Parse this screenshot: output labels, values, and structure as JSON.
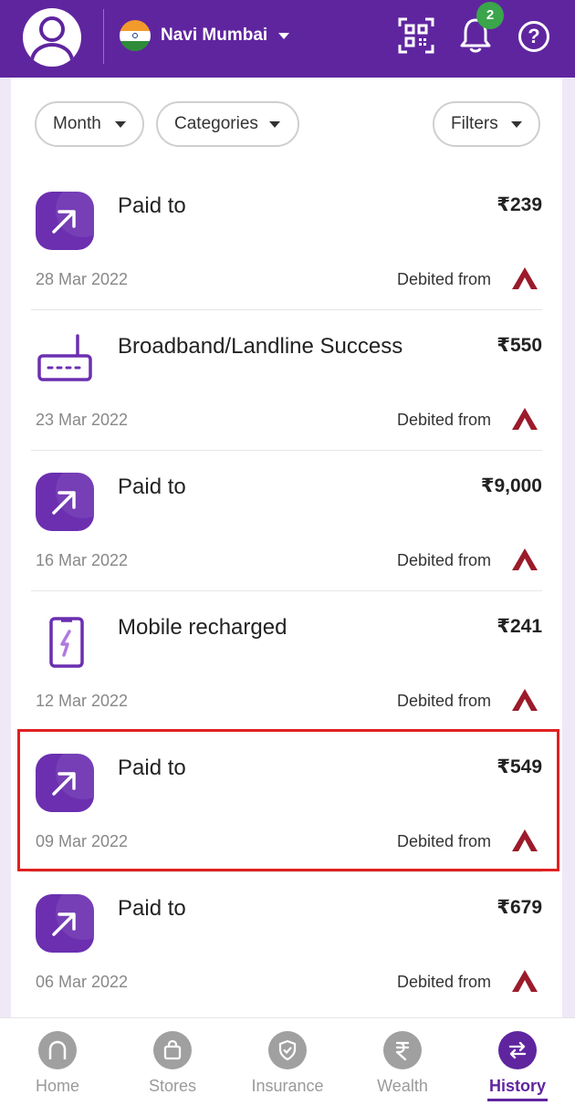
{
  "header": {
    "city": "Navi Mumbai",
    "notification_count": "2",
    "help_glyph": "?"
  },
  "filters": {
    "month": "Month",
    "categories": "Categories",
    "filters": "Filters"
  },
  "transactions": [
    {
      "title": "Paid to",
      "amount": "₹239",
      "date": "28 Mar 2022",
      "debit_label": "Debited from",
      "icon": "paid-arrow-icon"
    },
    {
      "title": "Broadband/Landline Success",
      "amount": "₹550",
      "date": "23 Mar 2022",
      "debit_label": "Debited from",
      "icon": "router-icon"
    },
    {
      "title": "Paid to",
      "amount": "₹9,000",
      "date": "16 Mar 2022",
      "debit_label": "Debited from",
      "icon": "paid-arrow-icon"
    },
    {
      "title": "Mobile recharged",
      "amount": "₹241",
      "date": "12 Mar 2022",
      "debit_label": "Debited from",
      "icon": "mobile-recharge-icon"
    },
    {
      "title": "Paid to",
      "amount": "₹549",
      "date": "09 Mar 2022",
      "debit_label": "Debited from",
      "icon": "paid-arrow-icon"
    },
    {
      "title": "Paid to",
      "amount": "₹679",
      "date": "06 Mar 2022",
      "debit_label": "Debited from",
      "icon": "paid-arrow-icon"
    }
  ],
  "nav": {
    "home": "Home",
    "stores": "Stores",
    "insurance": "Insurance",
    "wealth": "Wealth",
    "history": "History"
  },
  "colors": {
    "brand": "#5f259f",
    "highlight": "#e02020",
    "badge": "#3aa54b",
    "bank_logo": "#9b1b2a"
  }
}
